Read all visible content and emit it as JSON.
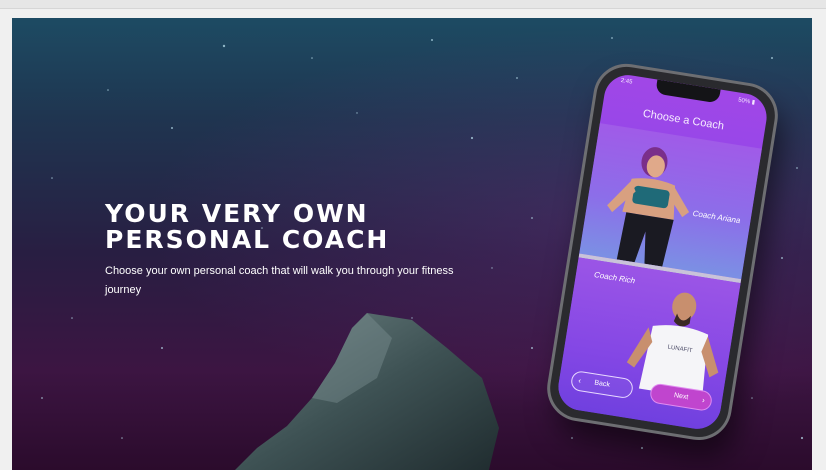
{
  "hero": {
    "headline_line1": "YOUR VERY OWN",
    "headline_line2": "PERSONAL COACH",
    "subtext": "Choose your own personal coach that will walk you through your fitness journey"
  },
  "phone": {
    "status_time": "2:45",
    "status_battery": "50%",
    "screen_title": "Choose a Coach",
    "coaches": [
      {
        "name": "Coach Ariana"
      },
      {
        "name": "Coach Rich",
        "shirt_text": "LUNAFIT"
      }
    ],
    "back_label": "Back",
    "next_label": "Next"
  },
  "colors": {
    "accent_purple": "#a147e7",
    "next_button": "#c045ce",
    "hero_top": "#1d4b63",
    "hero_bottom": "#2b0b2c"
  },
  "icons": [
    "chevron-left-icon",
    "chevron-right-icon",
    "battery-icon"
  ]
}
